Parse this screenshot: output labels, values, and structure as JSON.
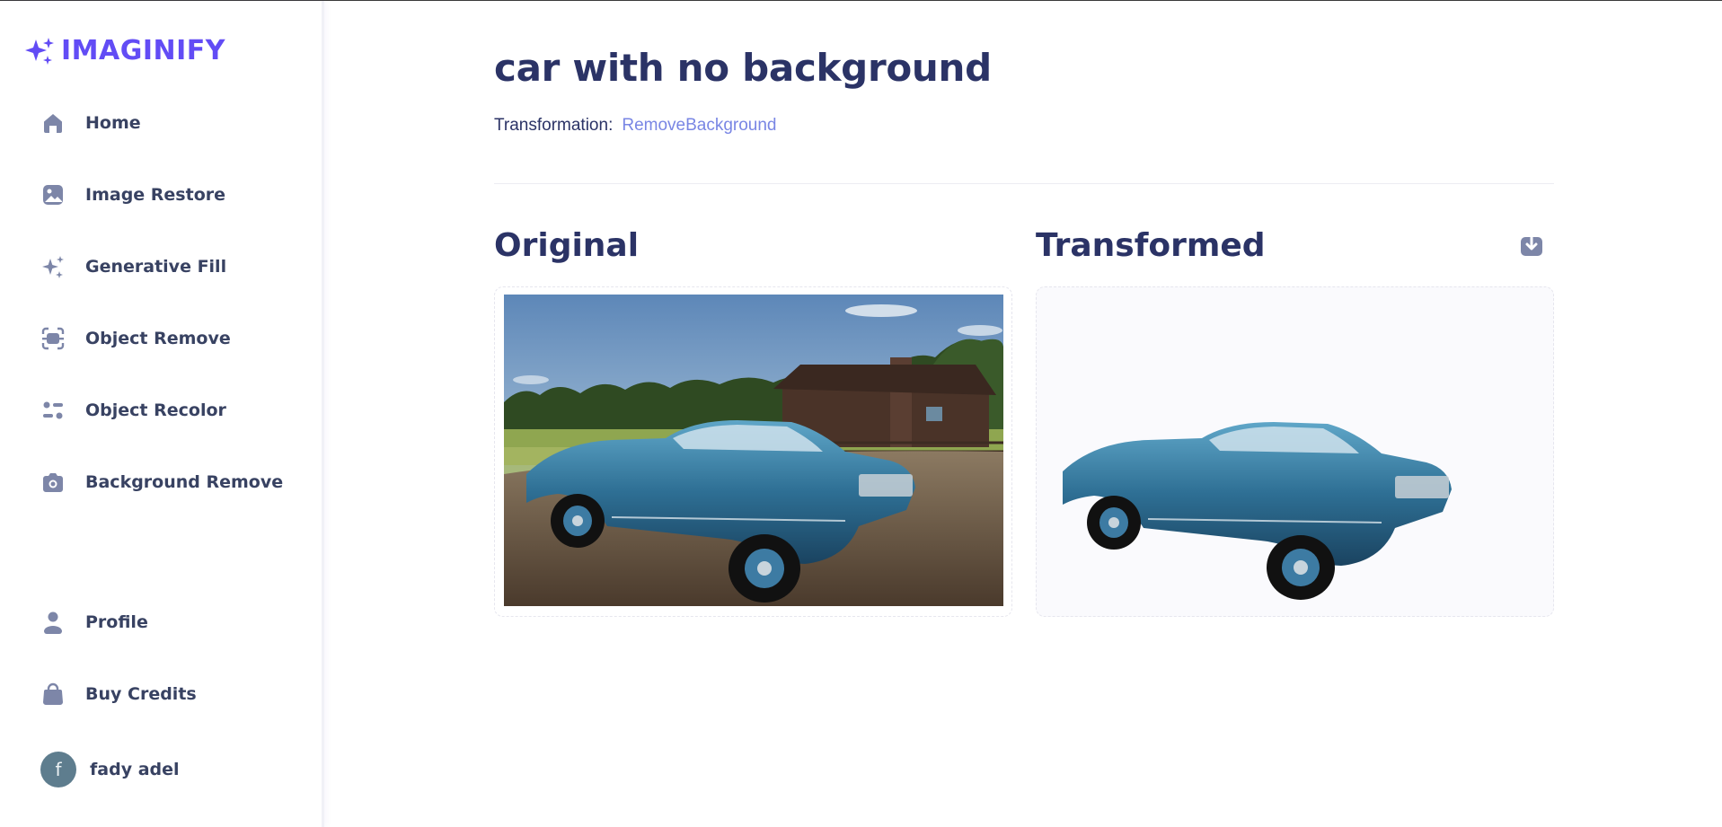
{
  "app": {
    "name": "IMAGINIFY"
  },
  "sidebar": {
    "items": [
      {
        "label": "Home",
        "icon": "home-icon"
      },
      {
        "label": "Image Restore",
        "icon": "image-icon"
      },
      {
        "label": "Generative Fill",
        "icon": "stars-icon"
      },
      {
        "label": "Object Remove",
        "icon": "scan-icon"
      },
      {
        "label": "Object Recolor",
        "icon": "filter-icon"
      },
      {
        "label": "Background Remove",
        "icon": "camera-icon"
      }
    ],
    "bottom_items": [
      {
        "label": "Profile",
        "icon": "user-icon"
      },
      {
        "label": "Buy Credits",
        "icon": "bag-icon"
      }
    ],
    "user": {
      "initial": "f",
      "name": "fady adel"
    }
  },
  "main": {
    "title": "car with no background",
    "transformation_label": "Transformation:",
    "transformation_value": "RemoveBackground",
    "original_heading": "Original",
    "transformed_heading": "Transformed"
  },
  "colors": {
    "brand": "#624cf5",
    "heading": "#2b3366",
    "link": "#7986e4",
    "icon": "#7d86a8"
  }
}
